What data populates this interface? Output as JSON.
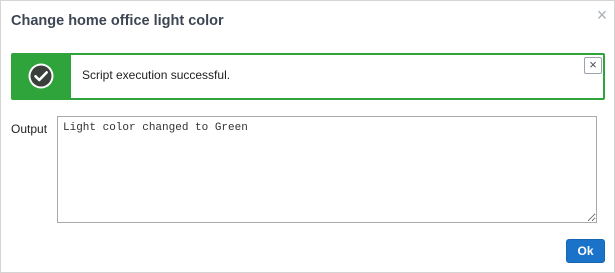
{
  "dialog": {
    "title": "Change home office light color",
    "close_glyph": "×"
  },
  "alert": {
    "icon": "check-circle-icon",
    "message": "Script execution successful.",
    "close_glyph": "×",
    "color": "#2fa43b"
  },
  "output": {
    "label": "Output",
    "value": "Light color changed to Green"
  },
  "footer": {
    "ok_label": "Ok",
    "accent_color": "#1a73c8"
  }
}
